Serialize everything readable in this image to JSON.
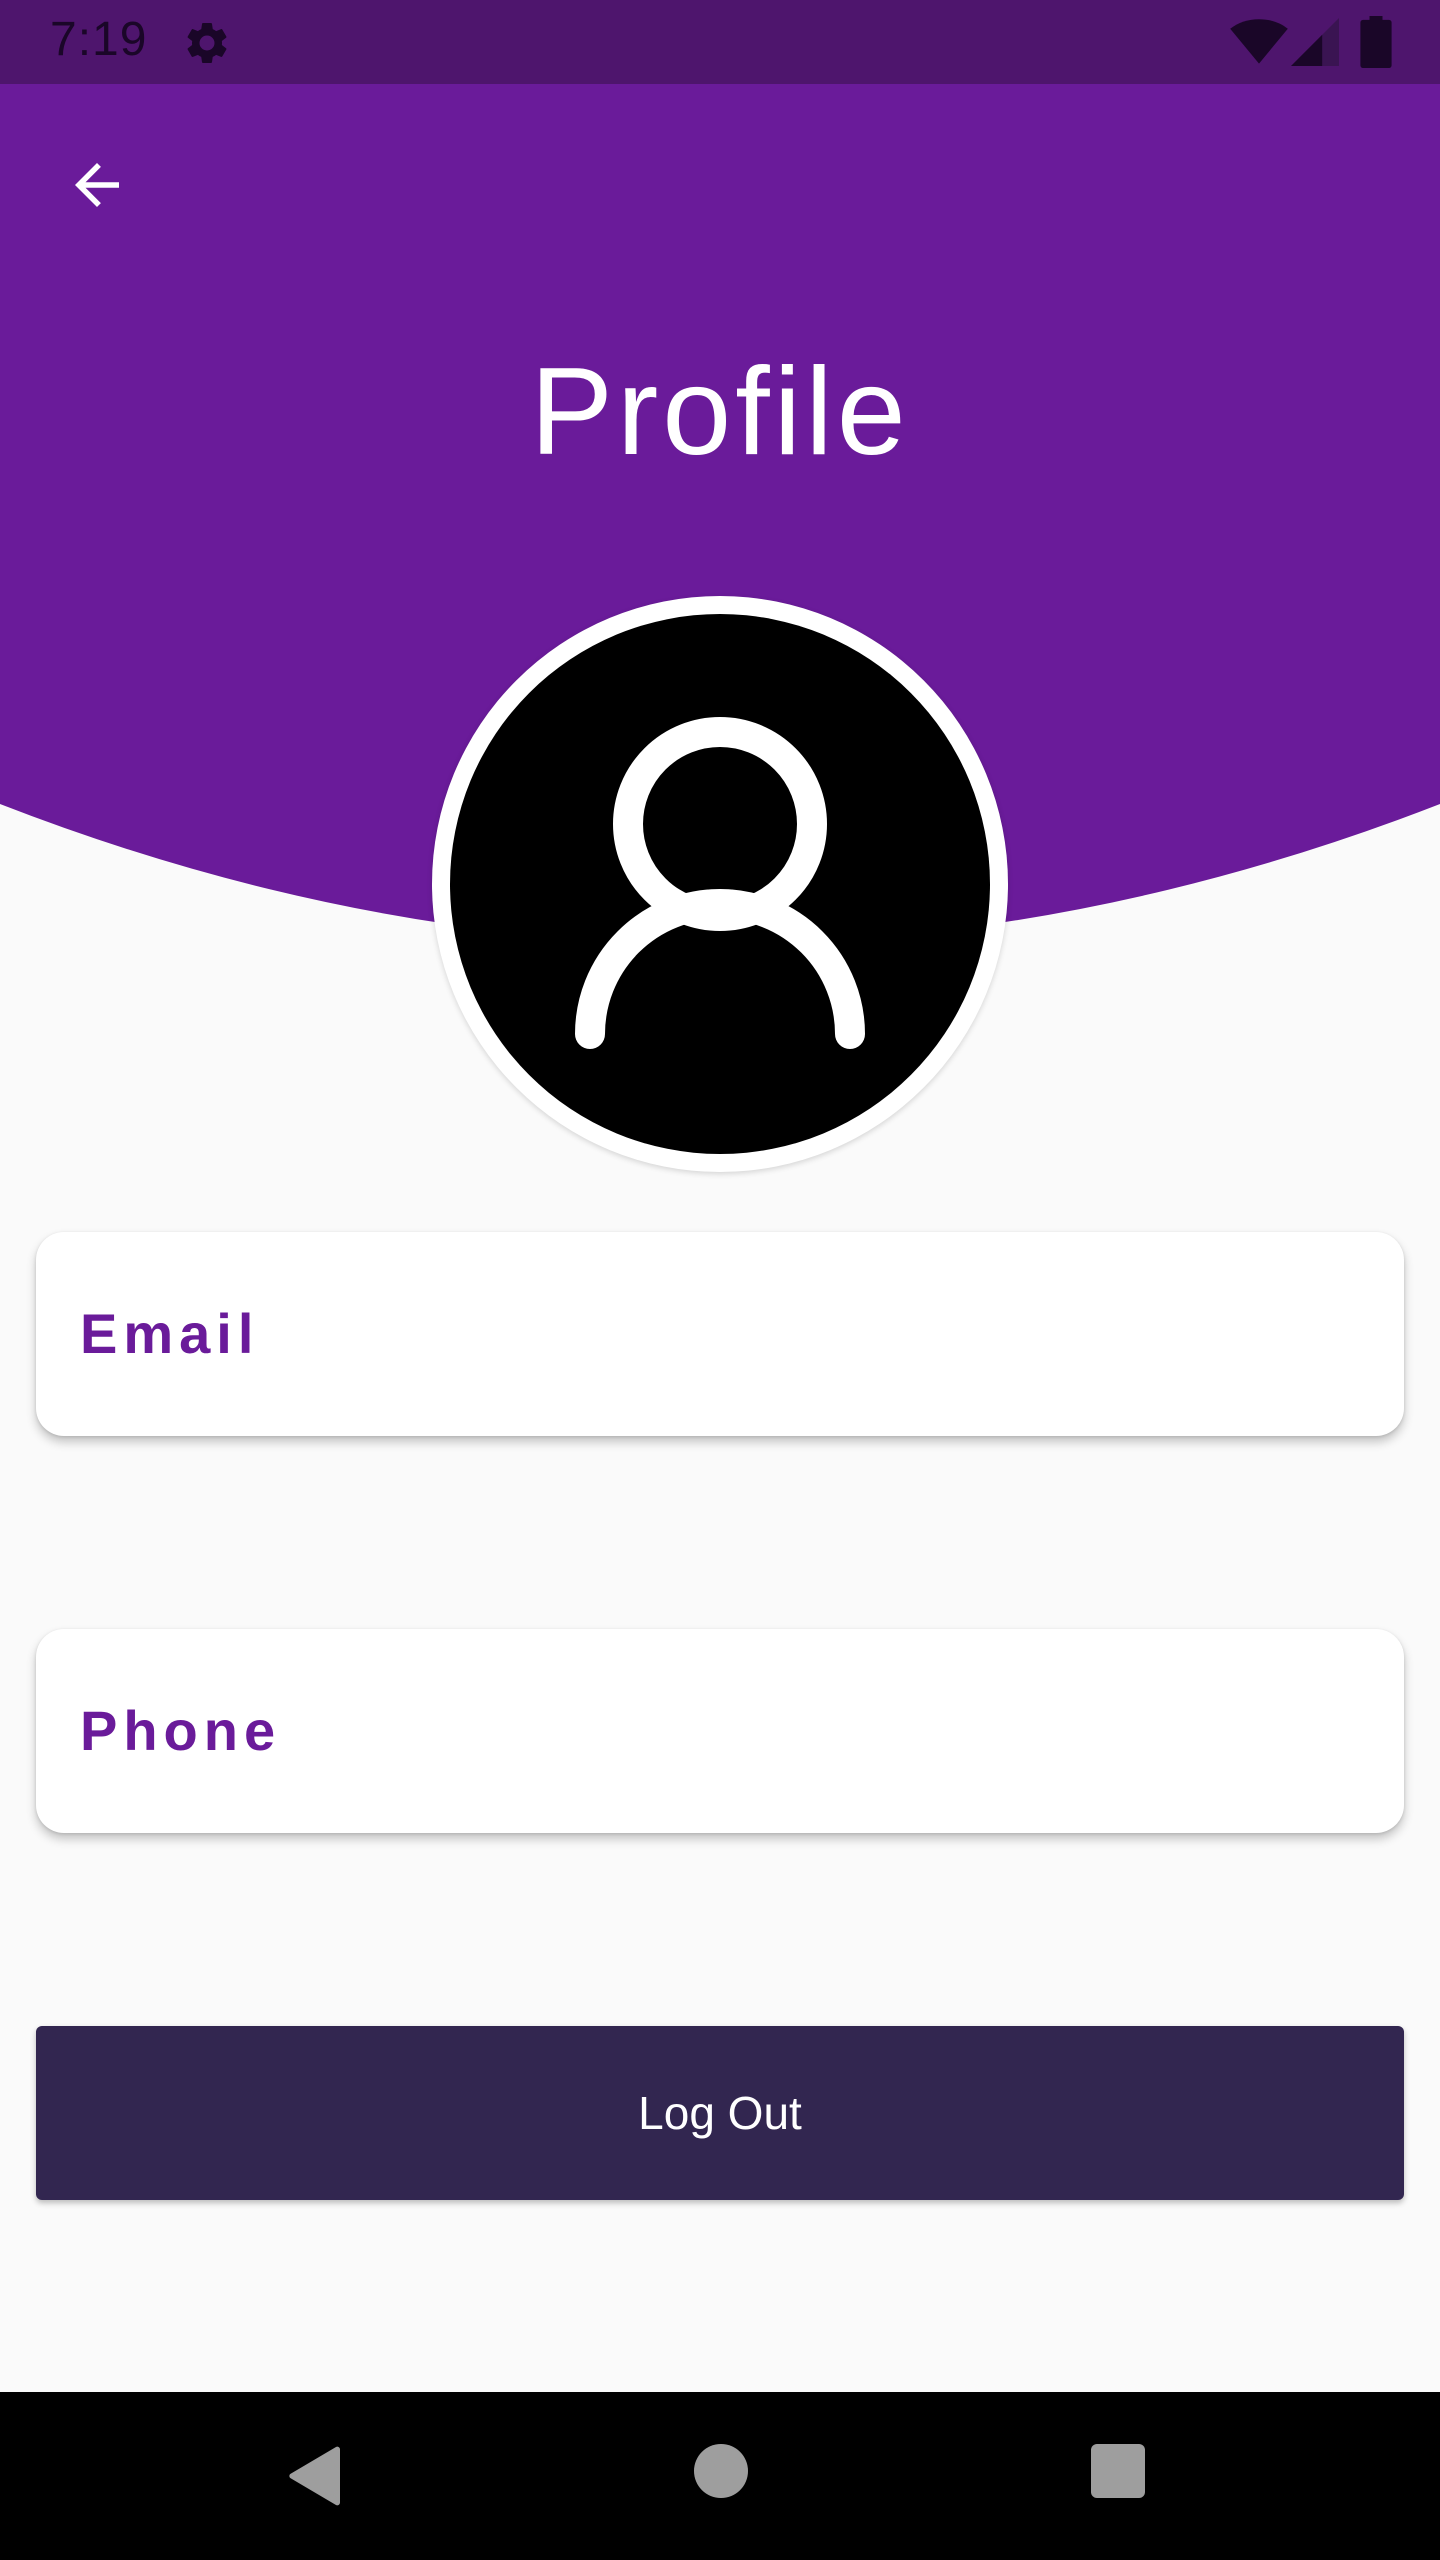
{
  "status_bar": {
    "time": "7:19",
    "icons": [
      "gear-icon",
      "wifi-icon",
      "signal-icon",
      "battery-icon"
    ]
  },
  "header": {
    "title": "Profile",
    "back_icon": "arrow-left-icon",
    "background_color": "#6a1b9a"
  },
  "avatar": {
    "icon": "person-outline-icon"
  },
  "fields": {
    "email_label": "Email",
    "phone_label": "Phone"
  },
  "logout": {
    "label": "Log Out",
    "color": "#322650"
  },
  "nav_bar": {
    "icons": [
      "nav-back-icon",
      "nav-home-icon",
      "nav-recents-icon"
    ]
  },
  "colors": {
    "primary": "#6a1b9a",
    "status_bar": "#4e156d",
    "background": "#fafafa"
  }
}
